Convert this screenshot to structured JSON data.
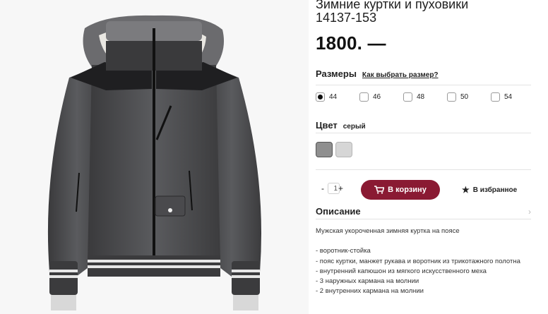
{
  "product": {
    "title_line1": "Зимние куртки и пуховики",
    "title_line2": "14137-153",
    "price": "1800. —",
    "image_icon": "jacket-photo"
  },
  "sizes": {
    "label": "Размеры",
    "guide_link": "Как выбрать размер?",
    "options": [
      "44",
      "46",
      "48",
      "50",
      "54"
    ],
    "selected": "44"
  },
  "color": {
    "label": "Цвет",
    "value": "серый",
    "swatches": [
      "#8f8f8f",
      "#d6d6d6"
    ]
  },
  "cart": {
    "minus": "-",
    "quantity": "1",
    "plus": "+",
    "button_label": "В корзину",
    "button_icon": "cart-icon",
    "button_color": "#8a1a33",
    "favorite_label": "В избранное",
    "favorite_icon": "star-icon"
  },
  "description": {
    "label": "Описание",
    "intro": "Мужская укороченная зимняя куртка на поясе",
    "items": [
      "- воротник-стойка",
      "- пояс куртки, манжет рукава и воротник из трикотажного полотна",
      "- внутренний капюшон из мягкого искусственного меха",
      "- 3 наружных кармана на молнии",
      "- 2 внутренних кармана на молнии"
    ]
  }
}
